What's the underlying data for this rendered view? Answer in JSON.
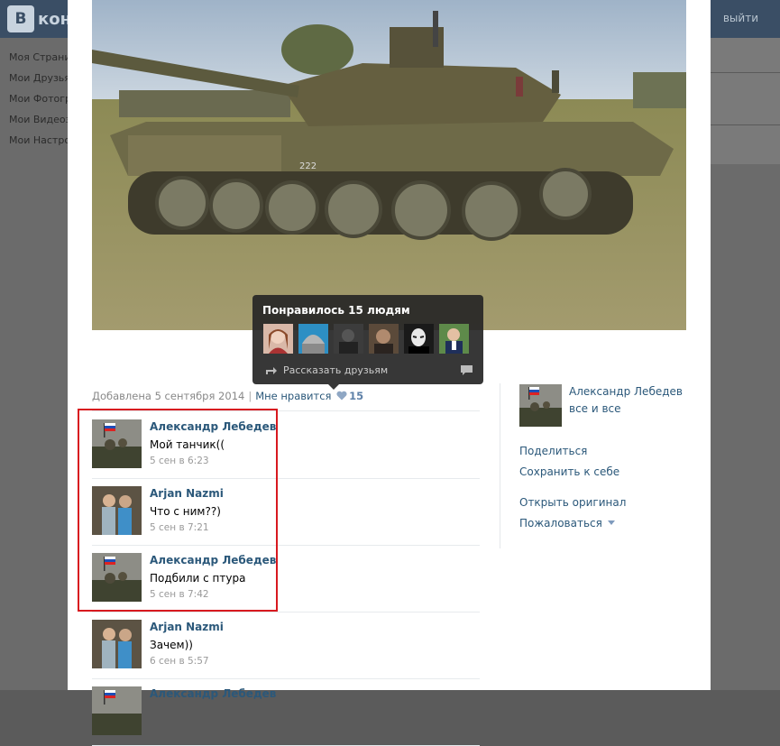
{
  "site": {
    "logo_text": "кон",
    "logout_label": "выйти"
  },
  "bg_nav": [
    "Моя Страни",
    "Мои Друзья",
    "Мои Фотогр",
    "Мои Видеоз",
    "Мои Настро"
  ],
  "likes_tooltip": {
    "title": "Понравилось 15 людям",
    "share_label": "Рассказать друзьям"
  },
  "meta": {
    "added": "Добавлена 5 сентября 2014",
    "separator": "|",
    "like_label": "Мне нравится",
    "like_count": "15"
  },
  "comments": [
    {
      "author": "Александр Лебедев",
      "text": "Мой танчик((",
      "time": "5 сен в 6:23"
    },
    {
      "author": "Arjan Nazmi",
      "text": "Что с ним??)",
      "time": "5 сен в 7:21"
    },
    {
      "author": "Александр Лебедев",
      "text": "Подбили с птура",
      "time": "5 сен в 7:42"
    },
    {
      "author": "Arjan Nazmi",
      "text": "Зачем))",
      "time": "6 сен в 5:57"
    },
    {
      "author": "Александр Лебедев",
      "text": "",
      "time": ""
    }
  ],
  "owner": {
    "name": "Александр Лебедев",
    "subtitle": "все и все"
  },
  "actions": {
    "share": "Поделиться",
    "save": "Сохранить к себе",
    "open_original": "Открыть оригинал",
    "report": "Пожаловаться"
  },
  "colors": {
    "link": "#2b587a",
    "header": "#3a4e65",
    "highlight_box": "#d8191f"
  }
}
